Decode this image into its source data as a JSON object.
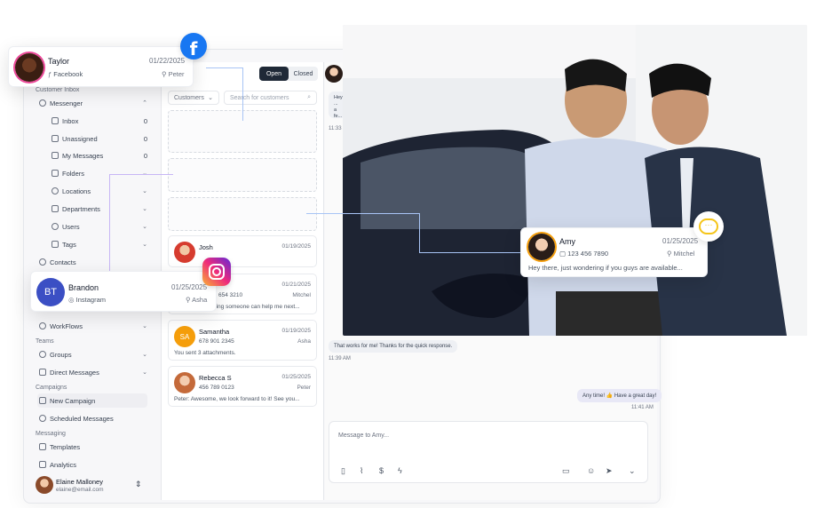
{
  "sidebar": {
    "customer_inbox_label": "Customer Inbox",
    "messenger": "Messenger",
    "inbox": {
      "label": "Inbox",
      "count": "0"
    },
    "unassigned": {
      "label": "Unassigned",
      "count": "0"
    },
    "my_messages": {
      "label": "My Messages",
      "count": "0"
    },
    "folders": "Folders",
    "locations": "Locations",
    "departments": "Departments",
    "users": "Users",
    "tags": "Tags",
    "contacts": "Contacts",
    "workflows": "WorkFlows",
    "teams_label": "Teams",
    "groups": "Groups",
    "direct_messages": "Direct Messages",
    "campaigns_label": "Campaigns",
    "new_campaign": "New Campaign",
    "scheduled_messages": "Scheduled Messages",
    "messaging_label": "Messaging",
    "templates": "Templates",
    "analytics": "Analytics",
    "user": {
      "name": "Elaine Malloney",
      "email": "elaine@email.com"
    }
  },
  "list": {
    "toggle_open": "Open",
    "toggle_closed": "Closed",
    "filter_customers": "Customers",
    "search_placeholder": "Search for customers",
    "conversations": [
      {
        "name": "Josh",
        "date": "01/19/2025",
        "phone": "",
        "agent": "",
        "msg": ""
      },
      {
        "name": "",
        "date": "01/21/2025",
        "phone": "654 3210",
        "agent": "Mitchel",
        "msg": "ping someone can help me next..."
      },
      {
        "name": "Samantha",
        "date": "01/19/2025",
        "phone": "678 901 2345",
        "agent": "Asha",
        "msg": "You sent 3 attachments.",
        "initials": "SA"
      },
      {
        "name": "Rebecca S",
        "date": "01/25/2025",
        "phone": "456 789 0123",
        "agent": "Peter",
        "msg": "Peter: Awesome, we look forward to it! See you..."
      }
    ]
  },
  "chat": {
    "top_bubble": "Hey ... a fe... ava...",
    "top_time": "11:33 AM",
    "bubble_customer": "That works for me! Thanks for the quick response.",
    "time_customer": "11:39 AM",
    "bubble_agent": "Any time! 👍 Have a great day!",
    "time_agent": "11:41 AM",
    "composer_placeholder": "Message to Amy..."
  },
  "cards": {
    "taylor": {
      "name": "Taylor",
      "date": "01/22/2025",
      "channel": "Facebook",
      "agent": "Peter"
    },
    "brandon": {
      "name": "Brandon",
      "initials": "BT",
      "date": "01/25/2025",
      "channel": "Instagram",
      "agent": "Asha"
    },
    "amy": {
      "name": "Amy",
      "date": "01/25/2025",
      "phone": "123 456 7890",
      "agent": "Mitchel",
      "msg": "Hey there, just wondering if you guys are available..."
    }
  },
  "colors": {
    "facebook": "#1877f2",
    "brandon_avatar": "#3b4fc4",
    "samantha_avatar": "#f59e0b",
    "connector": "#c7b6f5",
    "chat_badge": "#f5c518"
  }
}
